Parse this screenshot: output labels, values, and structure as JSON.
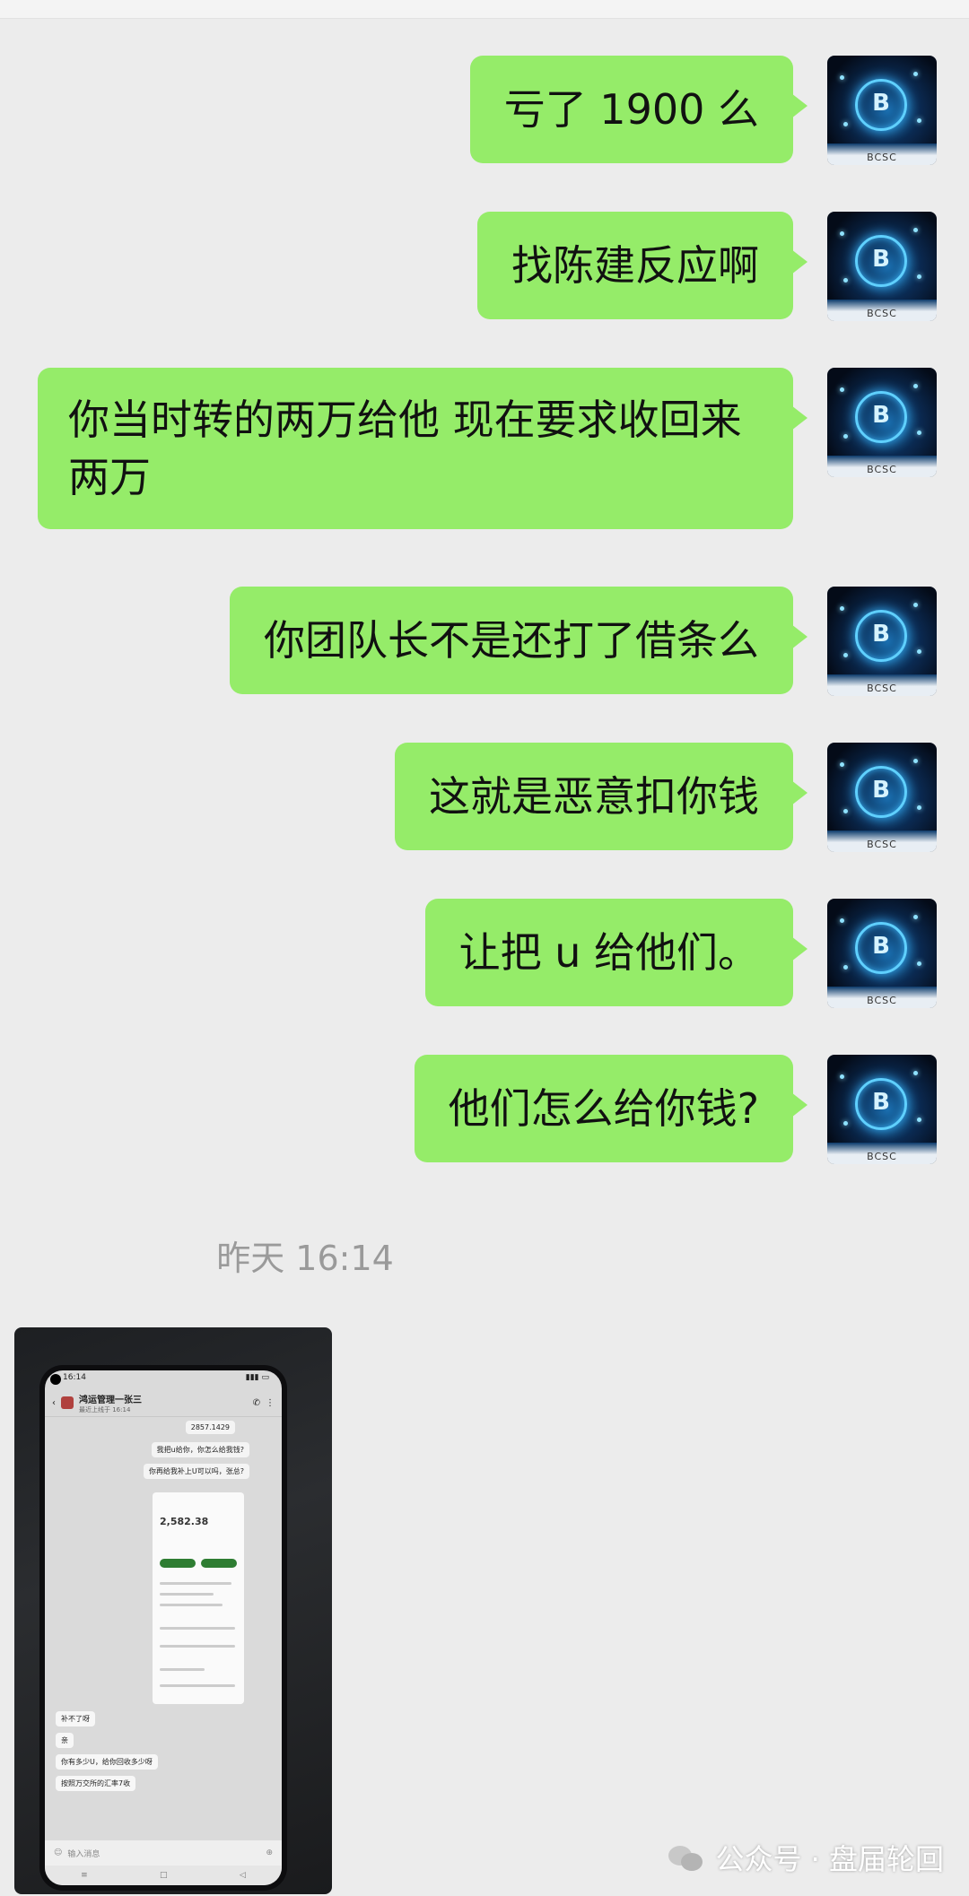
{
  "messages": [
    {
      "text": "亏了 1900 么"
    },
    {
      "text": "找陈建反应啊"
    },
    {
      "text": "你当时转的两万给他 现在要求收回来两万"
    },
    {
      "text": "你团队长不是还打了借条么"
    },
    {
      "text": "这就是恶意扣你钱"
    },
    {
      "text": "让把 u 给他们。"
    },
    {
      "text": "他们怎么给你钱?"
    }
  ],
  "avatar": {
    "badge": "B",
    "caption": "BCSC"
  },
  "timestamp": "昨天 16:14",
  "photo": {
    "status_time": "16:14",
    "contact_name": "鸿运管理一张三",
    "contact_sub": "最近上线于 16:14",
    "bubbles": {
      "b1": "2857.1429",
      "b2": "我把u给你，你怎么给我钱?",
      "b3": "你再给我补上U可以吗，张总?",
      "b4": "补不了呀",
      "b5": "亲",
      "b6": "你有多少U，给你回收多少呀",
      "b7": "按照万交所的汇率7收"
    },
    "shot_amount": "2,582.38",
    "input_placeholder": "输入消息"
  },
  "watermark": "公众号 · 盘届轮回"
}
